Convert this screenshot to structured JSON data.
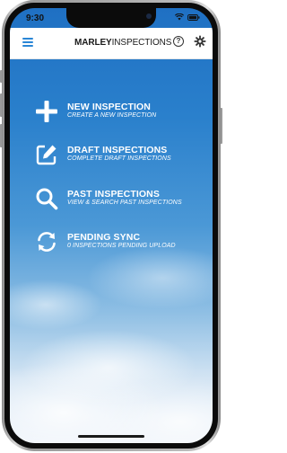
{
  "status_bar": {
    "time": "9:30"
  },
  "header": {
    "brand_bold": "MARLEY",
    "brand_regular": "INSPECTIONS",
    "help_symbol": "?"
  },
  "menu": {
    "items": [
      {
        "title": "NEW INSPECTION",
        "subtitle": "CREATE A NEW INSPECTION",
        "icon": "plus-icon"
      },
      {
        "title": "DRAFT INSPECTIONS",
        "subtitle": "COMPLETE DRAFT INSPECTIONS",
        "icon": "edit-icon"
      },
      {
        "title": "PAST INSPECTIONS",
        "subtitle": "VIEW & SEARCH PAST INSPECTIONS",
        "icon": "search-icon"
      },
      {
        "title": "PENDING SYNC",
        "subtitle": "0 INSPECTIONS PENDING UPLOAD",
        "icon": "sync-icon"
      }
    ]
  },
  "colors": {
    "accent": "#2a86d6",
    "sky_top": "#1f70c3",
    "sky_bottom": "#eef3fa"
  }
}
